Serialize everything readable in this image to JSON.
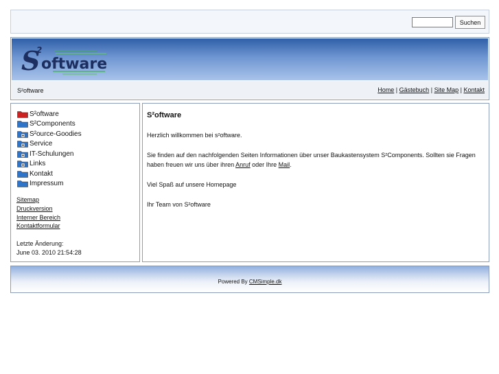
{
  "search": {
    "placeholder": "",
    "button_label": "Suchen"
  },
  "header": {
    "site_name": "S²oftware"
  },
  "top_links": [
    {
      "label": "Home"
    },
    {
      "label": "Gästebuch"
    },
    {
      "label": "Site Map"
    },
    {
      "label": "Kontakt"
    }
  ],
  "sidebar": {
    "menu": [
      {
        "label": "S²oftware",
        "icon": "folder-open-icon",
        "color": "#cc2222"
      },
      {
        "label": "S²Components",
        "icon": "folder-icon",
        "color": "#2f74c8"
      },
      {
        "label": "S²ource-Goodies",
        "icon": "folder-plus-icon",
        "color": "#2f74c8"
      },
      {
        "label": "Service",
        "icon": "folder-plus-icon",
        "color": "#2f74c8"
      },
      {
        "label": "IT-Schulungen",
        "icon": "folder-plus-icon",
        "color": "#2f74c8"
      },
      {
        "label": "Links",
        "icon": "folder-plus-icon",
        "color": "#2f74c8"
      },
      {
        "label": "Kontakt",
        "icon": "folder-icon",
        "color": "#2f74c8"
      },
      {
        "label": "Impressum",
        "icon": "folder-icon",
        "color": "#2f74c8"
      }
    ],
    "links": [
      {
        "label": "Sitemap"
      },
      {
        "label": "Druckversion"
      },
      {
        "label": "Interner Bereich"
      },
      {
        "label": "Kontaktformular"
      }
    ],
    "last_change_label": "Letzte Änderung:",
    "last_change_value": "June 03. 2010 21:54:28"
  },
  "content": {
    "title": "S²oftware",
    "p1": "Herzlich willkommen bei s²oftware.",
    "p2_before": "Sie finden auf den nachfolgenden Seiten Informationen über unser Baukastensystem S²Components. Sollten sie Fragen haben freuen wir uns über ihren ",
    "p2_link1": "Anruf",
    "p2_middle": " oder Ihre ",
    "p2_link2": "Mail",
    "p2_end": ".",
    "p3": "Viel Spaß auf unsere Homepage",
    "p4": "Ihr Team von S²oftware"
  },
  "footer": {
    "prefix": "Powered By ",
    "link": "CMSimple.dk"
  },
  "colors": {
    "accent": "#2f5fa8",
    "border": "#8a9cba"
  }
}
